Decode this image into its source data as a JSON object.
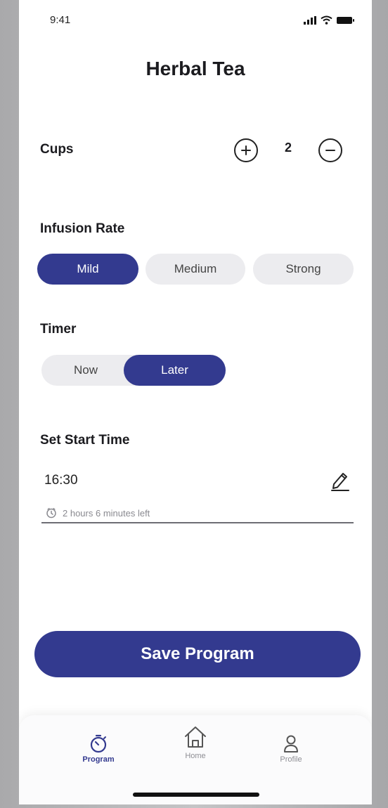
{
  "status_bar": {
    "time": "9:41",
    "icons": [
      "signal-icon",
      "wifi-icon",
      "battery-icon"
    ]
  },
  "title": "Herbal Tea",
  "cups": {
    "label": "Cups",
    "value": "2",
    "increase_icon": "plus-icon",
    "decrease_icon": "minus-icon"
  },
  "infusion_rate": {
    "label": "Infusion Rate",
    "options": [
      "Mild",
      "Medium",
      "Strong"
    ],
    "selected": "Mild"
  },
  "timer": {
    "label": "Timer",
    "options": [
      "Now",
      "Later"
    ],
    "selected": "Later"
  },
  "start_time": {
    "label": "Set Start Time",
    "value": "16:30",
    "hint": "2 hours 6 minutes left",
    "edit_icon": "pencil-icon",
    "hint_icon": "clock-icon"
  },
  "save_button": {
    "label": "Save Program"
  },
  "tab_bar": {
    "tabs": [
      {
        "label": "Program",
        "icon": "timer-icon",
        "active": true
      },
      {
        "label": "Home",
        "icon": "home-icon",
        "active": false
      },
      {
        "label": "Profile",
        "icon": "user-icon",
        "active": false
      }
    ]
  },
  "colors": {
    "accent": "#333a8f",
    "pill_inactive": "#ececef",
    "background": "#ffffff"
  }
}
